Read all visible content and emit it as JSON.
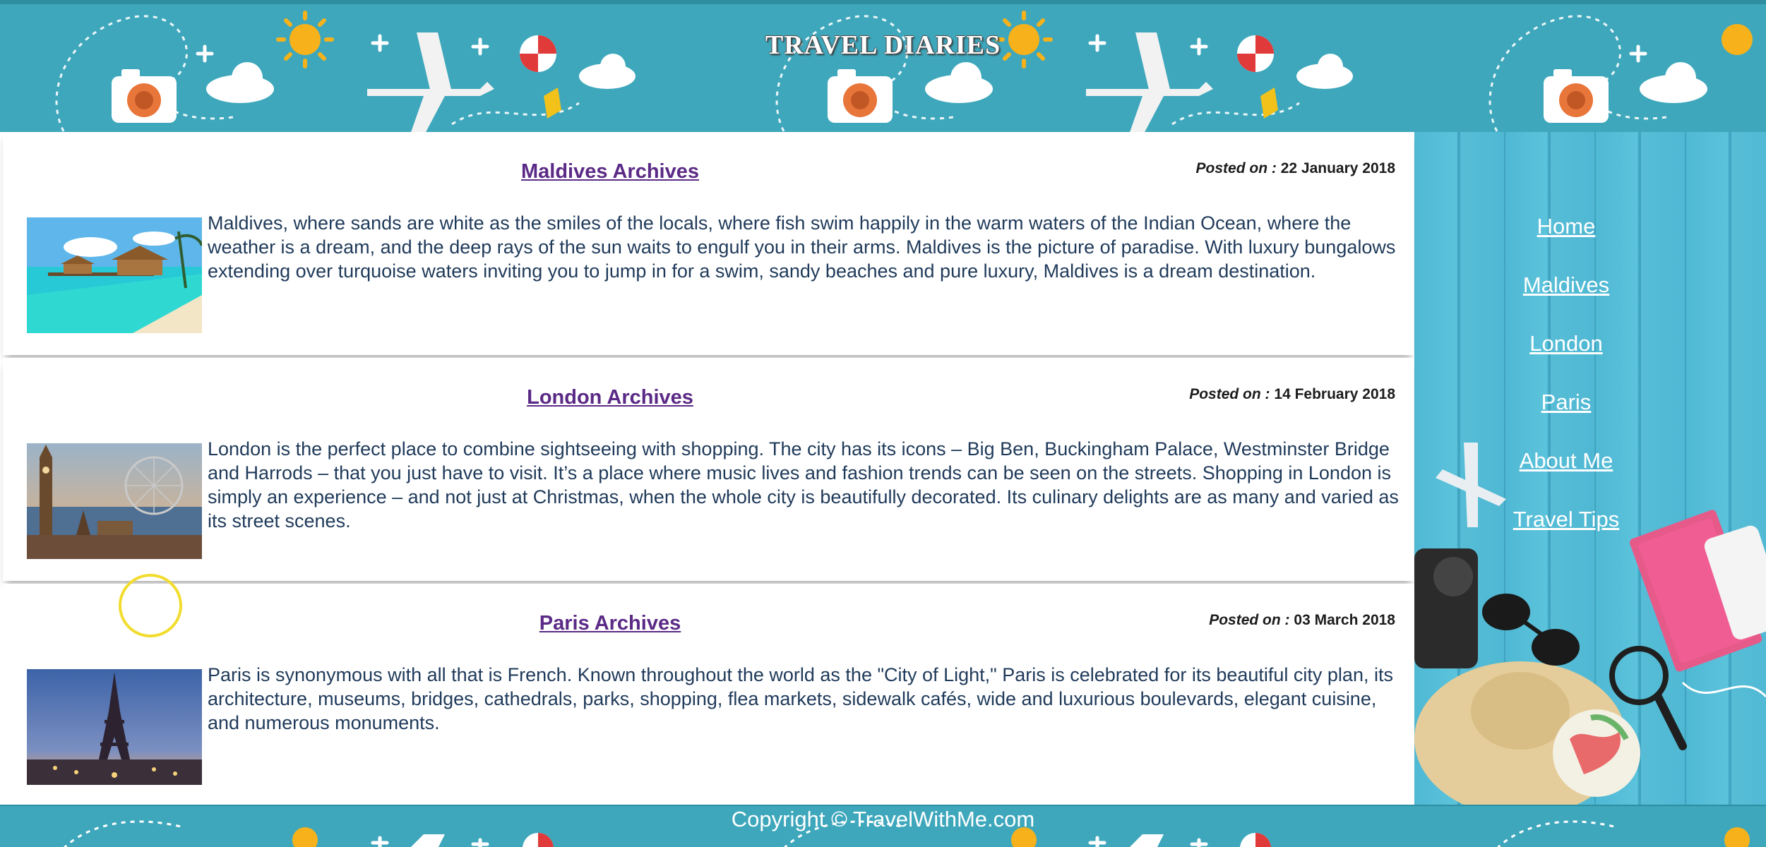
{
  "header": {
    "title": "TRAVEL DIARIES"
  },
  "posts": [
    {
      "title": "Maldives Archives",
      "date_label": "Posted on :",
      "date": "22 January 2018",
      "text": "Maldives, where sands are white as the smiles of the locals, where fish swim happily in the warm waters of the Indian Ocean, where the weather is a dream, and the deep rays of the sun waits to engulf you in their arms. Maldives is the picture of paradise. With luxury bungalows extending over turquoise waters inviting you to jump in for a swim, sandy beaches and pure luxury, Maldives is a dream destination."
    },
    {
      "title": "London Archives",
      "date_label": "Posted on :",
      "date": "14 February 2018",
      "text": "London is the perfect place to combine sightseeing with shopping. The city has its icons – Big Ben, Buckingham Palace, Westminster Bridge and Harrods – that you just have to visit. It’s a place where music lives and fashion trends can be seen on the streets. Shopping in London is simply an experience – and not just at Christmas, when the whole city is beautifully decorated. Its culinary delights are as many and varied as its street scenes."
    },
    {
      "title": "Paris Archives",
      "date_label": "Posted on :",
      "date": "03 March 2018",
      "text": "Paris is synonymous with all that is French. Known throughout the world as the \"City of Light,\" Paris is celebrated for its beautiful city plan, its architecture, museums, bridges, cathedrals, parks, shopping, flea markets, sidewalk cafés, wide and luxurious boulevards, elegant cuisine, and numerous monuments."
    }
  ],
  "nav": [
    "Home",
    "Maldives",
    "London",
    "Paris",
    "About Me",
    "Travel Tips"
  ],
  "footer": {
    "copyright": "Copyright © TravelWithMe.com"
  },
  "colors": {
    "banner": "#3ea7bc",
    "title_link": "#5b2a86",
    "body_text": "#1f3a5a",
    "sidebar": "#4fb8d3"
  }
}
